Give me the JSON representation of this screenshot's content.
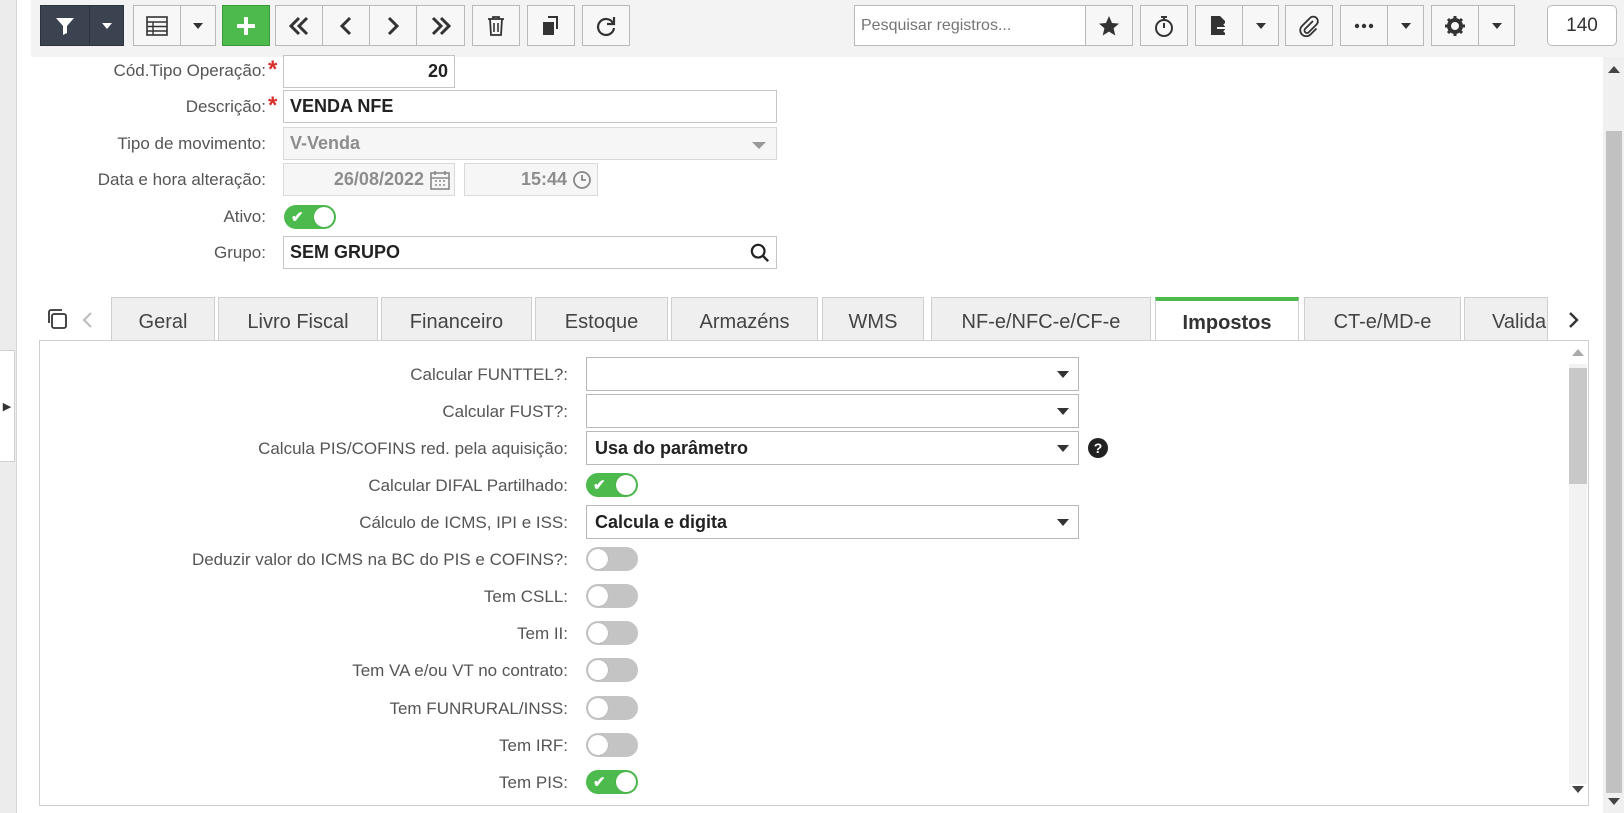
{
  "toolbar": {
    "search_placeholder": "Pesquisar registros...",
    "record_count": "140"
  },
  "form": {
    "cod_label": "Cód.Tipo Operação:",
    "cod_value": "20",
    "desc_label": "Descrição:",
    "desc_value": "VENDA NFE",
    "tipo_label": "Tipo de movimento:",
    "tipo_value": "V-Venda",
    "data_label": "Data e hora alteração:",
    "date_value": "26/08/2022",
    "time_value": "15:44",
    "ativo_label": "Ativo:",
    "ativo_on": true,
    "grupo_label": "Grupo:",
    "grupo_value": "SEM GRUPO"
  },
  "tabs": [
    {
      "label": "Geral"
    },
    {
      "label": "Livro Fiscal"
    },
    {
      "label": "Financeiro"
    },
    {
      "label": "Estoque"
    },
    {
      "label": "Armazéns"
    },
    {
      "label": "WMS"
    },
    {
      "label": "NF-e/NFC-e/CF-e"
    },
    {
      "label": "Impostos",
      "active": true
    },
    {
      "label": "CT-e/MD-e"
    },
    {
      "label": "Valida"
    }
  ],
  "impostos": {
    "funttel_label": "Calcular FUNTTEL?:",
    "funttel_value": "",
    "fust_label": "Calcular FUST?:",
    "fust_value": "",
    "piscofins_label": "Calcula PIS/COFINS red. pela aquisição:",
    "piscofins_value": "Usa do parâmetro",
    "difal_label": "Calcular DIFAL Partilhado:",
    "difal_on": true,
    "icms_label": "Cálculo de ICMS, IPI e ISS:",
    "icms_value": "Calcula e digita",
    "toggles": [
      {
        "label": "Deduzir valor do ICMS na BC do PIS e COFINS?:",
        "on": false
      },
      {
        "label": "Tem CSLL:",
        "on": false
      },
      {
        "label": "Tem II:",
        "on": false
      },
      {
        "label": "Tem VA e/ou VT no contrato:",
        "on": false
      },
      {
        "label": "Tem FUNRURAL/INSS:",
        "on": false
      },
      {
        "label": "Tem IRF:",
        "on": false
      },
      {
        "label": "Tem PIS:",
        "on": true
      }
    ]
  },
  "colors": {
    "accent": "#4cba4c",
    "required": "#d9302b",
    "dark_button": "#3b4250"
  }
}
